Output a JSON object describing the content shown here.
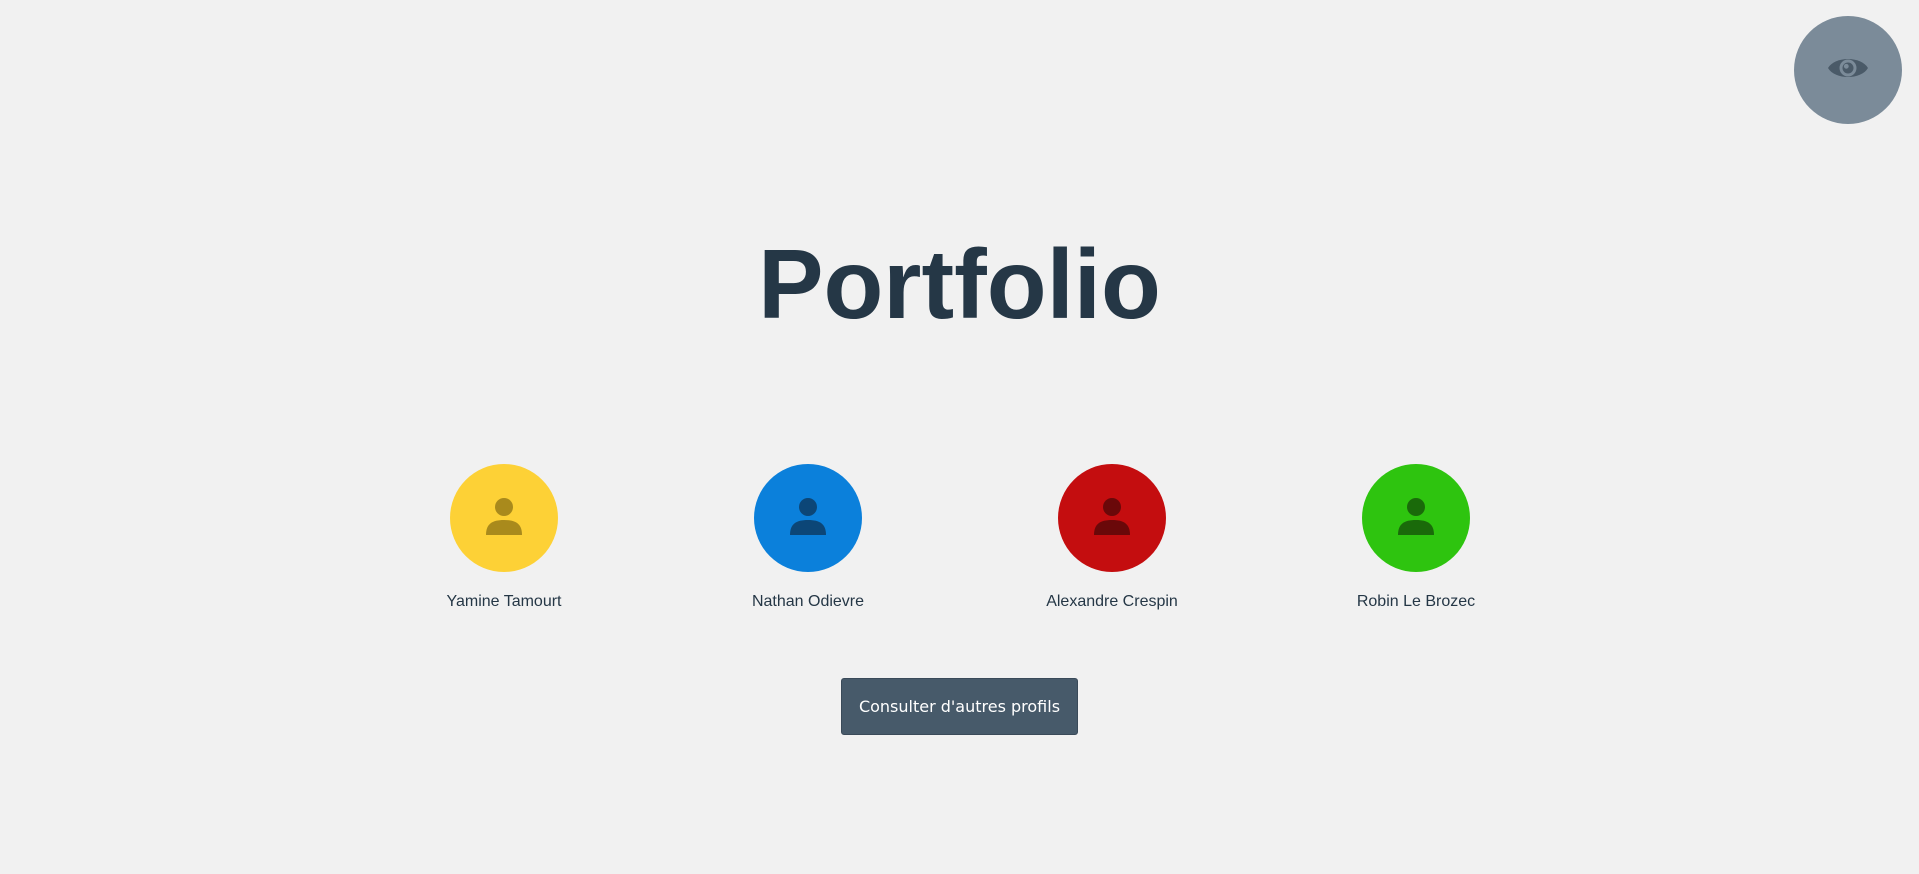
{
  "header": {
    "view_toggle_icon": "eye-icon",
    "view_toggle_color": "#7b8b99",
    "view_toggle_icon_color": "#4a5a68"
  },
  "main": {
    "title": "Portfolio",
    "title_color": "#253746"
  },
  "profiles": [
    {
      "name": "Yamine Tamourt",
      "icon": "person-icon",
      "color": "#fdd136",
      "icon_color": "#a98a1c"
    },
    {
      "name": "Nathan Odievre",
      "icon": "person-icon",
      "color": "#0b80db",
      "icon_color": "#0c4677"
    },
    {
      "name": "Alexandre Crespin",
      "icon": "person-icon",
      "color": "#c40d0f",
      "icon_color": "#6a0809"
    },
    {
      "name": "Robin Le Brozec",
      "icon": "person-icon",
      "color": "#2ec40f",
      "icon_color": "#1a6a0a"
    }
  ],
  "actions": {
    "more_profiles_label": "Consulter d'autres profils",
    "button_color": "#475a6a"
  }
}
